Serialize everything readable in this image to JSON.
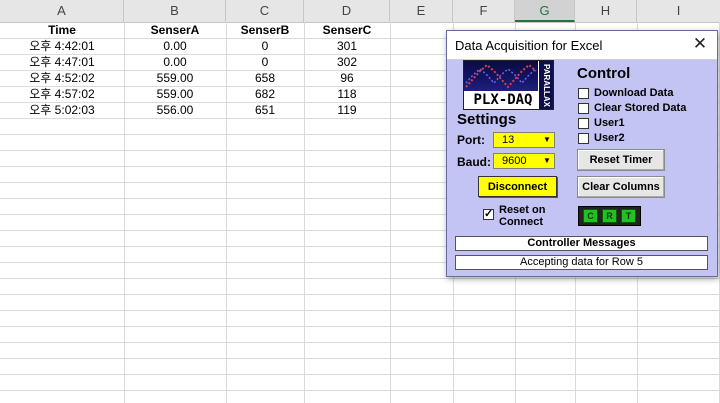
{
  "sheet": {
    "columns": [
      "A",
      "B",
      "C",
      "D",
      "E",
      "F",
      "G",
      "H",
      "I"
    ],
    "selected_column": "G",
    "header_row": [
      "Time",
      "SenserA",
      "SenserB",
      "SenserC"
    ],
    "rows": [
      [
        "오후 4:42:01",
        "0.00",
        "0",
        "301"
      ],
      [
        "오후 4:47:01",
        "0.00",
        "0",
        "302"
      ],
      [
        "오후 4:52:02",
        "559.00",
        "658",
        "96"
      ],
      [
        "오후 4:57:02",
        "559.00",
        "682",
        "118"
      ],
      [
        "오후 5:02:03",
        "556.00",
        "651",
        "119"
      ]
    ]
  },
  "dialog": {
    "title": "Data Acquisition for Excel",
    "close_glyph": "✕",
    "logo_text": "PLX-DAQ",
    "logo_side_text": "PARALLAX",
    "settings": {
      "heading": "Settings",
      "port_label": "Port:",
      "port_value": "13",
      "baud_label": "Baud:",
      "baud_value": "9600",
      "disconnect_label": "Disconnect",
      "reset_on_connect_label_1": "Reset on",
      "reset_on_connect_label_2": "Connect",
      "reset_on_connect_checked": true
    },
    "control": {
      "heading": "Control",
      "download_data": "Download Data",
      "clear_stored_data": "Clear Stored Data",
      "user1": "User1",
      "user2": "User2",
      "reset_timer": "Reset Timer",
      "clear_columns": "Clear Columns",
      "crt_leds": [
        "C",
        "R",
        "T"
      ]
    },
    "messages_header": "Controller Messages",
    "status_message": "Accepting data for Row 5"
  },
  "colors": {
    "dialog_bg": "#c4c4f4",
    "highlight": "#ffff00",
    "led_green": "#22c022",
    "excel_green": "#217346"
  }
}
